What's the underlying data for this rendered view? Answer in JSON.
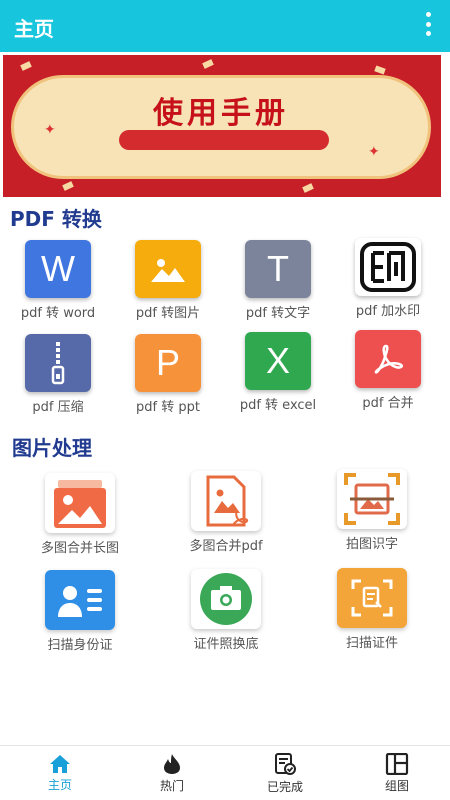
{
  "appbar": {
    "title": "主页"
  },
  "banner": {
    "title": "使用手册"
  },
  "pdf_section": {
    "title": "PDF 转换",
    "items": [
      {
        "label": "pdf 转 word",
        "glyph": "W",
        "color": "#3f76df"
      },
      {
        "label": "pdf 转图片",
        "glyph": "",
        "color": "#f6ac0c"
      },
      {
        "label": "pdf 转文字",
        "glyph": "T",
        "color": "#7b849a"
      },
      {
        "label": "pdf 加水印",
        "glyph": "",
        "color": "#ffffff"
      },
      {
        "label": "pdf 压缩",
        "glyph": "",
        "color": "#5669a8"
      },
      {
        "label": "pdf 转 ppt",
        "glyph": "P",
        "color": "#f6923a"
      },
      {
        "label": "pdf 转 excel",
        "glyph": "X",
        "color": "#2fa84f"
      },
      {
        "label": "pdf 合并",
        "glyph": "",
        "color": "#ee4f4f"
      }
    ]
  },
  "image_section": {
    "title": "图片处理",
    "items": [
      {
        "label": "多图合并长图"
      },
      {
        "label": "多图合并pdf"
      },
      {
        "label": "拍图识字"
      },
      {
        "label": "扫描身份证"
      },
      {
        "label": "证件照换底"
      },
      {
        "label": "扫描证件"
      }
    ]
  },
  "bottom_nav": [
    {
      "label": "主页",
      "active": true
    },
    {
      "label": "热门"
    },
    {
      "label": "已完成"
    },
    {
      "label": "组图"
    }
  ],
  "colors": {
    "accent": "#17c5dc",
    "section_title": "#203b8f",
    "active_tab": "#1aa0d8"
  }
}
